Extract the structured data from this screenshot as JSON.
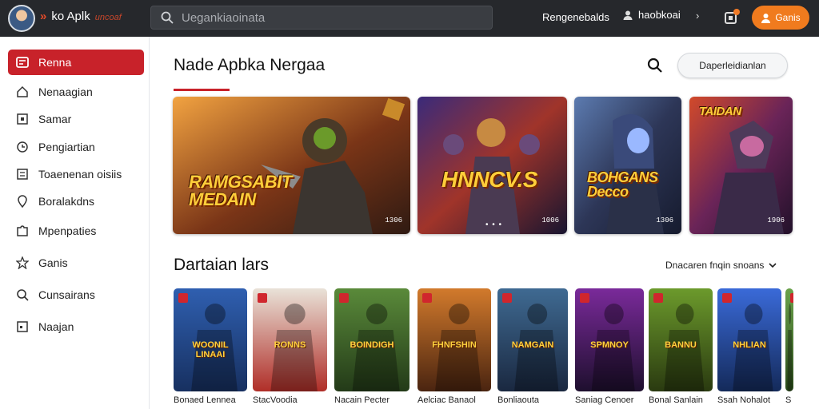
{
  "topbar": {
    "brand_mark": "»",
    "brand_name": "ko  Aplk",
    "brand_sub": "uncoaf",
    "search_placeholder": "Uegankiaoinata",
    "link_recommended": "Rengenebalds",
    "user_name": "haobkoai",
    "games_button": "Ganis",
    "icons": [
      "avatar",
      "search-icon",
      "user-icon",
      "chevron-down-icon",
      "bell-icon",
      "gamepad-icon"
    ]
  },
  "sidebar": {
    "items": [
      {
        "label": "Renna",
        "icon": "home-icon",
        "active": true
      },
      {
        "label": "Nenaagian",
        "icon": "house-icon",
        "active": false
      },
      {
        "label": "Samar",
        "icon": "square-icon",
        "active": false
      },
      {
        "label": "Pengiartian",
        "icon": "clock-icon",
        "active": false
      },
      {
        "label": "Toaenenan oisiis",
        "icon": "list-icon",
        "active": false
      },
      {
        "label": "Boralakdns",
        "icon": "pin-icon",
        "active": false
      },
      {
        "label": "Mpenpaties",
        "icon": "puzzle-icon",
        "active": false
      },
      {
        "label": "Ganis",
        "icon": "star-icon",
        "active": false
      },
      {
        "label": "Cunsairans",
        "icon": "search-icon",
        "active": false
      },
      {
        "label": "Naajan",
        "icon": "square-dot-icon",
        "active": false
      }
    ]
  },
  "main": {
    "title": "Nade Apbka Nergaa",
    "dropdown_label": "Daperleidianlan",
    "banners": [
      {
        "title": "RAMGSABIT MEDAIN",
        "code": "1306",
        "palette": [
          "#f2a341",
          "#7a3517",
          "#2f1a12"
        ]
      },
      {
        "title": "HNNCV.S",
        "code": "1006",
        "dots": "• • •",
        "palette": [
          "#3a2a7a",
          "#a0342a",
          "#181530"
        ]
      },
      {
        "title": "BOHGANS Decco",
        "code": "1306",
        "palette": [
          "#5c7bb0",
          "#2d3657",
          "#161b2e"
        ]
      },
      {
        "title": "TAIDAN",
        "code": "1906",
        "palette": [
          "#d24a2a",
          "#6a2458",
          "#22112a"
        ]
      }
    ],
    "section_title": "Dartaian lars",
    "section_filter": "Dnacaren fnqin snoans",
    "tiles": [
      {
        "label": "Bonaed Lennea",
        "text": "WOONIL LINAAI",
        "palette": [
          "#2f5fb0",
          "#173060"
        ]
      },
      {
        "label": "StacVoodia",
        "text": "RONNS",
        "palette": [
          "#e9e2d8",
          "#b02e28"
        ]
      },
      {
        "label": "Nacain Pecter",
        "text": "BOINDIGH",
        "palette": [
          "#5a8a3a",
          "#233a18"
        ]
      },
      {
        "label": "Aelciac Banaol",
        "text": "FHNFSHIN",
        "palette": [
          "#d27a2c",
          "#4a2410"
        ]
      },
      {
        "label": "Bonliaouta",
        "text": "NAMGAIN",
        "palette": [
          "#3f6a92",
          "#1a2840"
        ]
      },
      {
        "label": "Saniag Cenoer",
        "text": "SPMNOY",
        "palette": [
          "#7a2a9a",
          "#1e0f2e"
        ]
      },
      {
        "label": "Bonal Sanlain",
        "text": "BANNU",
        "palette": [
          "#6c9a2c",
          "#2a3a10"
        ]
      },
      {
        "label": "Ssah Nohalot",
        "text": "NHLIAN",
        "palette": [
          "#3a6ad8",
          "#142a5a"
        ]
      },
      {
        "label": "S",
        "text": "",
        "palette": [
          "#6aa24a",
          "#2a4a1a"
        ]
      }
    ]
  },
  "colors": {
    "accent": "#c8222a",
    "topbar": "#26282c",
    "games_button": "#f07b1e"
  }
}
